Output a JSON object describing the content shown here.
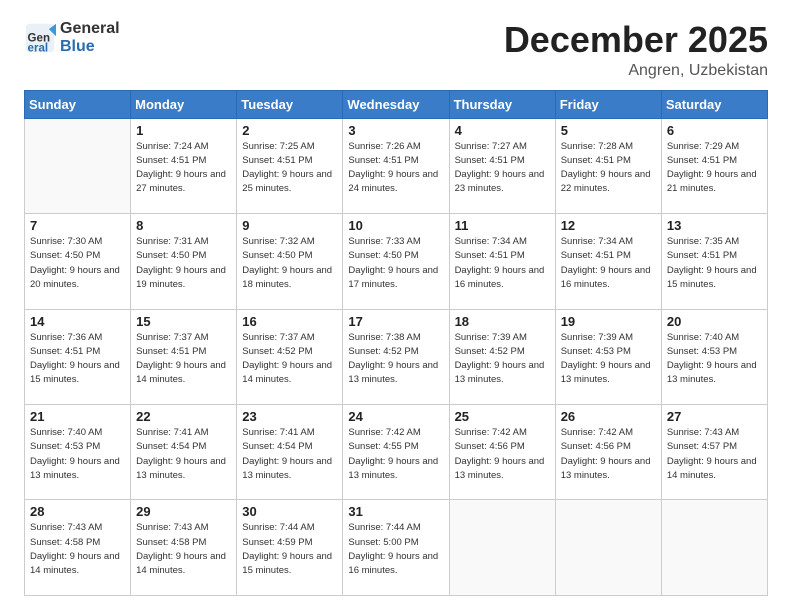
{
  "logo": {
    "general": "General",
    "blue": "Blue"
  },
  "header": {
    "month_year": "December 2025",
    "location": "Angren, Uzbekistan"
  },
  "weekdays": [
    "Sunday",
    "Monday",
    "Tuesday",
    "Wednesday",
    "Thursday",
    "Friday",
    "Saturday"
  ],
  "weeks": [
    [
      {
        "day": "",
        "sunrise": "",
        "sunset": "",
        "daylight": "",
        "empty": true
      },
      {
        "day": "1",
        "sunrise": "7:24 AM",
        "sunset": "4:51 PM",
        "daylight": "9 hours and 27 minutes."
      },
      {
        "day": "2",
        "sunrise": "7:25 AM",
        "sunset": "4:51 PM",
        "daylight": "9 hours and 25 minutes."
      },
      {
        "day": "3",
        "sunrise": "7:26 AM",
        "sunset": "4:51 PM",
        "daylight": "9 hours and 24 minutes."
      },
      {
        "day": "4",
        "sunrise": "7:27 AM",
        "sunset": "4:51 PM",
        "daylight": "9 hours and 23 minutes."
      },
      {
        "day": "5",
        "sunrise": "7:28 AM",
        "sunset": "4:51 PM",
        "daylight": "9 hours and 22 minutes."
      },
      {
        "day": "6",
        "sunrise": "7:29 AM",
        "sunset": "4:51 PM",
        "daylight": "9 hours and 21 minutes."
      }
    ],
    [
      {
        "day": "7",
        "sunrise": "7:30 AM",
        "sunset": "4:50 PM",
        "daylight": "9 hours and 20 minutes."
      },
      {
        "day": "8",
        "sunrise": "7:31 AM",
        "sunset": "4:50 PM",
        "daylight": "9 hours and 19 minutes."
      },
      {
        "day": "9",
        "sunrise": "7:32 AM",
        "sunset": "4:50 PM",
        "daylight": "9 hours and 18 minutes."
      },
      {
        "day": "10",
        "sunrise": "7:33 AM",
        "sunset": "4:50 PM",
        "daylight": "9 hours and 17 minutes."
      },
      {
        "day": "11",
        "sunrise": "7:34 AM",
        "sunset": "4:51 PM",
        "daylight": "9 hours and 16 minutes."
      },
      {
        "day": "12",
        "sunrise": "7:34 AM",
        "sunset": "4:51 PM",
        "daylight": "9 hours and 16 minutes."
      },
      {
        "day": "13",
        "sunrise": "7:35 AM",
        "sunset": "4:51 PM",
        "daylight": "9 hours and 15 minutes."
      }
    ],
    [
      {
        "day": "14",
        "sunrise": "7:36 AM",
        "sunset": "4:51 PM",
        "daylight": "9 hours and 15 minutes."
      },
      {
        "day": "15",
        "sunrise": "7:37 AM",
        "sunset": "4:51 PM",
        "daylight": "9 hours and 14 minutes."
      },
      {
        "day": "16",
        "sunrise": "7:37 AM",
        "sunset": "4:52 PM",
        "daylight": "9 hours and 14 minutes."
      },
      {
        "day": "17",
        "sunrise": "7:38 AM",
        "sunset": "4:52 PM",
        "daylight": "9 hours and 13 minutes."
      },
      {
        "day": "18",
        "sunrise": "7:39 AM",
        "sunset": "4:52 PM",
        "daylight": "9 hours and 13 minutes."
      },
      {
        "day": "19",
        "sunrise": "7:39 AM",
        "sunset": "4:53 PM",
        "daylight": "9 hours and 13 minutes."
      },
      {
        "day": "20",
        "sunrise": "7:40 AM",
        "sunset": "4:53 PM",
        "daylight": "9 hours and 13 minutes."
      }
    ],
    [
      {
        "day": "21",
        "sunrise": "7:40 AM",
        "sunset": "4:53 PM",
        "daylight": "9 hours and 13 minutes."
      },
      {
        "day": "22",
        "sunrise": "7:41 AM",
        "sunset": "4:54 PM",
        "daylight": "9 hours and 13 minutes."
      },
      {
        "day": "23",
        "sunrise": "7:41 AM",
        "sunset": "4:54 PM",
        "daylight": "9 hours and 13 minutes."
      },
      {
        "day": "24",
        "sunrise": "7:42 AM",
        "sunset": "4:55 PM",
        "daylight": "9 hours and 13 minutes."
      },
      {
        "day": "25",
        "sunrise": "7:42 AM",
        "sunset": "4:56 PM",
        "daylight": "9 hours and 13 minutes."
      },
      {
        "day": "26",
        "sunrise": "7:42 AM",
        "sunset": "4:56 PM",
        "daylight": "9 hours and 13 minutes."
      },
      {
        "day": "27",
        "sunrise": "7:43 AM",
        "sunset": "4:57 PM",
        "daylight": "9 hours and 14 minutes."
      }
    ],
    [
      {
        "day": "28",
        "sunrise": "7:43 AM",
        "sunset": "4:58 PM",
        "daylight": "9 hours and 14 minutes."
      },
      {
        "day": "29",
        "sunrise": "7:43 AM",
        "sunset": "4:58 PM",
        "daylight": "9 hours and 14 minutes."
      },
      {
        "day": "30",
        "sunrise": "7:44 AM",
        "sunset": "4:59 PM",
        "daylight": "9 hours and 15 minutes."
      },
      {
        "day": "31",
        "sunrise": "7:44 AM",
        "sunset": "5:00 PM",
        "daylight": "9 hours and 16 minutes."
      },
      {
        "day": "",
        "sunrise": "",
        "sunset": "",
        "daylight": "",
        "empty": true
      },
      {
        "day": "",
        "sunrise": "",
        "sunset": "",
        "daylight": "",
        "empty": true
      },
      {
        "day": "",
        "sunrise": "",
        "sunset": "",
        "daylight": "",
        "empty": true
      }
    ]
  ],
  "labels": {
    "sunrise": "Sunrise:",
    "sunset": "Sunset:",
    "daylight": "Daylight:"
  }
}
